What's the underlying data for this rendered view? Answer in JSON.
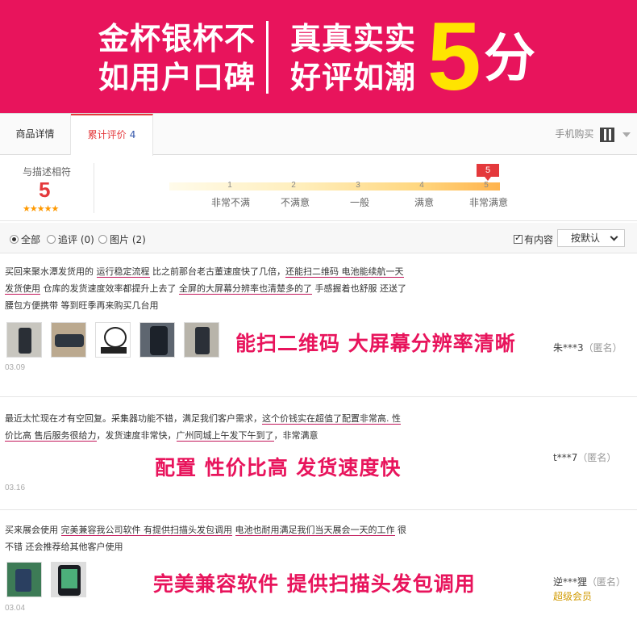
{
  "banner": {
    "left_line1": "金杯银杯不",
    "left_line2": "如用户口碑",
    "mid_line1": "真真实实",
    "mid_line2": "好评如潮",
    "score": "5",
    "unit": "分"
  },
  "tabs": {
    "details": "商品详情",
    "reviews": "累计评价",
    "reviews_count": "4",
    "mobile_buy": "手机购买"
  },
  "rating": {
    "label": "与描述相符",
    "score": "5",
    "stars": "★★★★★",
    "ticks": [
      "1",
      "2",
      "3",
      "4",
      "5"
    ],
    "levels": [
      "非常不满",
      "不满意",
      "一般",
      "满意",
      "非常满意"
    ],
    "marker": "5"
  },
  "filter": {
    "all": "全部",
    "followup": "追评 (0)",
    "images": "图片 (2)",
    "has_content": "有内容",
    "sort": "按默认"
  },
  "reviews": [
    {
      "parts": [
        "买回来聚水潭发货用的 ",
        "运行稳定流程",
        " 比之前那台老古董速度快了几倍，",
        "还能扫二维码 电池能续航一天发货使用",
        " 仓库的发货速度效率都提升上去了 ",
        "全屏的大屏幕分辨率也清楚多的了",
        " 手感握着也舒服 还送了腰包方便携带 等到旺季再来购买几台用"
      ],
      "callout": "能扫二维码 大屏幕分辨率清晰",
      "date": "03.09",
      "user": "朱***3",
      "anon": "（匿名）"
    },
    {
      "parts": [
        "最近太忙现在才有空回复。采集器功能不错，满足我们客户需求，",
        "这个价钱实在超值了配置非常高. 性价比高 售后服务很给力",
        "，发货速度非常快，",
        "广州同城上午发下午到了",
        "，非常满意"
      ],
      "callout": "配置 性价比高 发货速度快",
      "date": "03.16",
      "user": "t***7",
      "anon": "（匿名）"
    },
    {
      "parts": [
        "买来展会使用 ",
        "完美兼容我公司软件 有提供扫描头发包调用",
        " ",
        "电池也耐用满足我们当天展会一天的工作",
        " 很不错 还会推荐给其他客户使用"
      ],
      "callout": "完美兼容软件 提供扫描头发包调用",
      "date": "03.04",
      "user": "逆***狸",
      "anon": "（匿名）",
      "member": "超级会员"
    }
  ],
  "colors": {
    "banner_bg": "#e8145c",
    "banner_accent": "#ffe400",
    "active_tab": "#e4393c",
    "callout": "#e8145c"
  },
  "icons": [
    "qr-code-icon",
    "caret-down-icon",
    "radio-icon",
    "checkbox-icon",
    "dropdown-arrow-icon"
  ]
}
